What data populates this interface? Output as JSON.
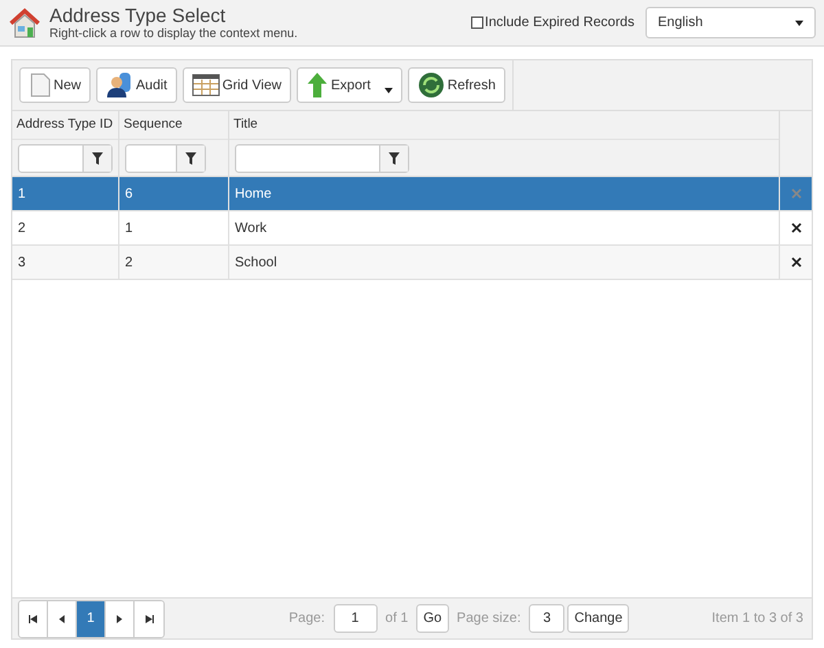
{
  "header": {
    "title": "Address Type Select",
    "subtitle": "Right-click a row to display the context menu.",
    "include_expired": {
      "label": "Include Expired Records",
      "checked": false
    },
    "language": {
      "value": "English"
    }
  },
  "toolbar": [
    {
      "kind": "new",
      "label": "New"
    },
    {
      "kind": "audit",
      "label": "Audit"
    },
    {
      "kind": "grid",
      "label": "Grid View"
    },
    {
      "kind": "export",
      "label": "Export"
    },
    {
      "kind": "refresh",
      "label": "Refresh"
    }
  ],
  "table": {
    "columns": [
      {
        "label": "Address Type ID"
      },
      {
        "label": "Sequence"
      },
      {
        "label": "Title"
      }
    ],
    "rows": [
      {
        "cells": [
          "1",
          "6",
          "Home"
        ],
        "selected": true
      },
      {
        "cells": [
          "2",
          "1",
          "Work"
        ],
        "selected": false
      },
      {
        "cells": [
          "3",
          "2",
          "School"
        ],
        "selected": false
      }
    ]
  },
  "pager": {
    "pages": [
      {
        "label": "1",
        "selected": true
      }
    ],
    "page_label": "Page:",
    "page_value": "1",
    "of_label": "of 1",
    "go": "Go",
    "size_label": "Page size:",
    "size_value": "3",
    "change": "Change",
    "summary": "Item 1 to 3 of 3"
  }
}
